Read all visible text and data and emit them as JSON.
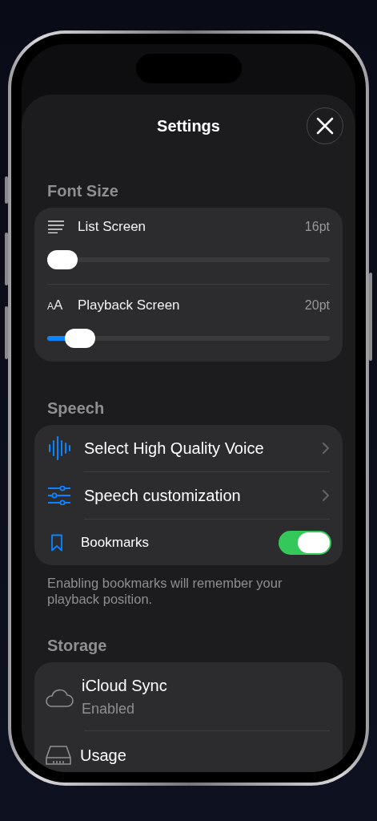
{
  "title": "Settings",
  "font_size": {
    "heading": "Font Size",
    "rows": [
      {
        "label": "List Screen",
        "value": "16pt",
        "level": 0
      },
      {
        "symbol": "AA",
        "label": "Playback Screen",
        "value": "20pt",
        "level": 0.07
      }
    ]
  },
  "speech": {
    "heading": "Speech",
    "rows": [
      {
        "kind": "link",
        "label": "Select High Quality Voice"
      },
      {
        "kind": "link",
        "label": "Speech customization"
      },
      {
        "kind": "toggle",
        "label": "Bookmarks",
        "on": true
      }
    ],
    "footnote": "Enabling bookmarks will remember your playback position."
  },
  "storage": {
    "heading": "Storage",
    "rows": [
      {
        "label": "iCloud Sync",
        "subtitle": "Enabled"
      },
      {
        "label": "Usage"
      }
    ]
  }
}
